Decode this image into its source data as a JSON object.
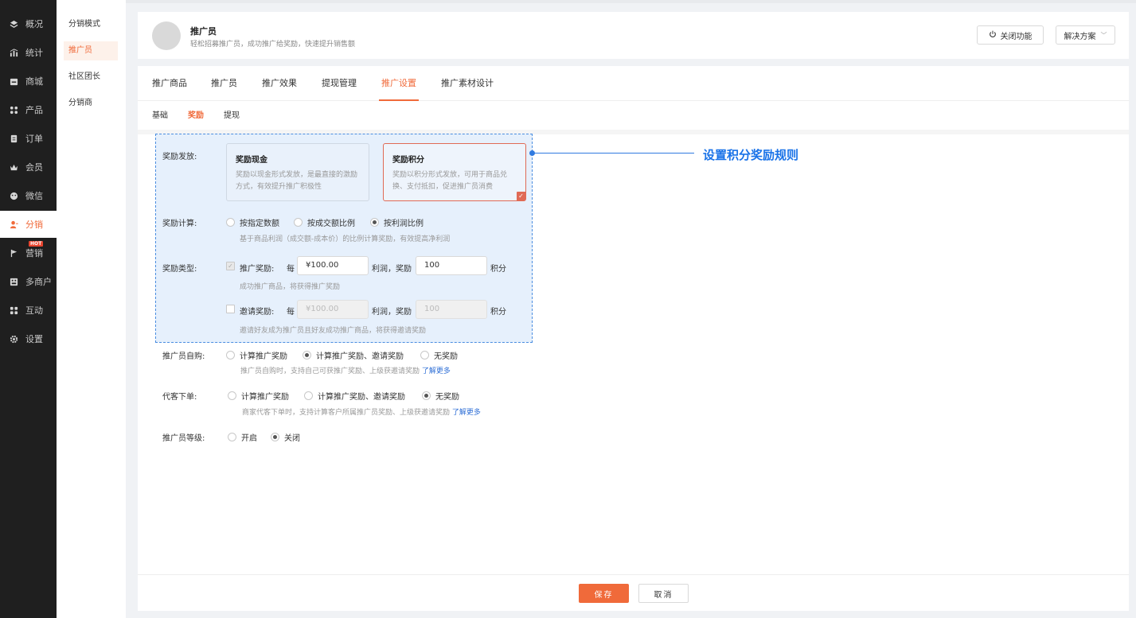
{
  "sidebar": {
    "items": [
      {
        "label": "概况",
        "icon": "layers-icon"
      },
      {
        "label": "统计",
        "icon": "chart-icon"
      },
      {
        "label": "商城",
        "icon": "store-icon"
      },
      {
        "label": "产品",
        "icon": "grid-icon"
      },
      {
        "label": "订单",
        "icon": "clipboard-icon"
      },
      {
        "label": "会员",
        "icon": "crown-icon"
      },
      {
        "label": "微信",
        "icon": "wechat-icon"
      },
      {
        "label": "分销",
        "icon": "user-share-icon"
      },
      {
        "label": "营销",
        "icon": "flag-icon",
        "badge": "HOT"
      },
      {
        "label": "多商户",
        "icon": "shop-icon"
      },
      {
        "label": "互动",
        "icon": "apps-icon"
      },
      {
        "label": "设置",
        "icon": "gear-icon"
      }
    ],
    "active": "分销"
  },
  "submenu": {
    "items": [
      "分销模式",
      "推广员",
      "社区团长",
      "分销商"
    ],
    "active": "推广员"
  },
  "header": {
    "title": "推广员",
    "subtitle": "轻松招募推广员，成功推广给奖励，快速提升销售额",
    "close_button": "关闭功能",
    "solution_button": "解决方案"
  },
  "tabs": [
    "推广商品",
    "推广员",
    "推广效果",
    "提现管理",
    "推广设置",
    "推广素材设计"
  ],
  "active_tab": "推广设置",
  "subtabs": [
    "基础",
    "奖励",
    "提现"
  ],
  "active_subtab": "奖励",
  "reward_issue": {
    "label": "奖励发放:",
    "options": [
      {
        "title": "奖励现金",
        "desc": "奖励以现金形式发放，是最直接的激励方式，有效提升推广积极性"
      },
      {
        "title": "奖励积分",
        "desc": "奖励以积分形式发放，可用于商品兑换、支付抵扣，促进推广员消费",
        "selected": true
      }
    ]
  },
  "reward_calc": {
    "label": "奖励计算:",
    "options": [
      "按指定数额",
      "按成交额比例",
      "按利润比例"
    ],
    "selected": "按利润比例",
    "hint": "基于商品利润（成交额-成本价）的比例计算奖励，有效提高净利润"
  },
  "reward_type": {
    "label": "奖励类型:",
    "promo": {
      "label": "推广奖励:",
      "per": "每",
      "amount": "¥100.00",
      "mid": "利润，奖励",
      "points": "100",
      "unit": "积分",
      "hint": "成功推广商品，将获得推广奖励"
    },
    "invite": {
      "label": "邀请奖励:",
      "per": "每",
      "amount_placeholder": "¥100.00",
      "mid": "利润，奖励",
      "points_placeholder": "100",
      "unit": "积分",
      "hint": "邀请好友成为推广员且好友成功推广商品，将获得邀请奖励"
    }
  },
  "self_purchase": {
    "label": "推广员自购:",
    "options": [
      "计算推广奖励",
      "计算推广奖励、邀请奖励",
      "无奖励"
    ],
    "selected": "计算推广奖励、邀请奖励",
    "hint": "推广员自购时，支持自己可获推广奖励、上级获邀请奖励",
    "link": "了解更多"
  },
  "proxy_order": {
    "label": "代客下单:",
    "options": [
      "计算推广奖励",
      "计算推广奖励、邀请奖励",
      "无奖励"
    ],
    "selected": "无奖励",
    "hint": "商家代客下单时，支持计算客户所属推广员奖励、上级获邀请奖励",
    "link": "了解更多"
  },
  "promoter_level": {
    "label": "推广员等级:",
    "options": [
      "开启",
      "关闭"
    ],
    "selected": "关闭"
  },
  "footer": {
    "save": "保存",
    "cancel": "取消"
  },
  "annotation": "设置积分奖励规则",
  "colors": {
    "accent": "#f06a3a",
    "annotation": "#1a73e8",
    "highlight_bg": "#e6f0fc"
  }
}
